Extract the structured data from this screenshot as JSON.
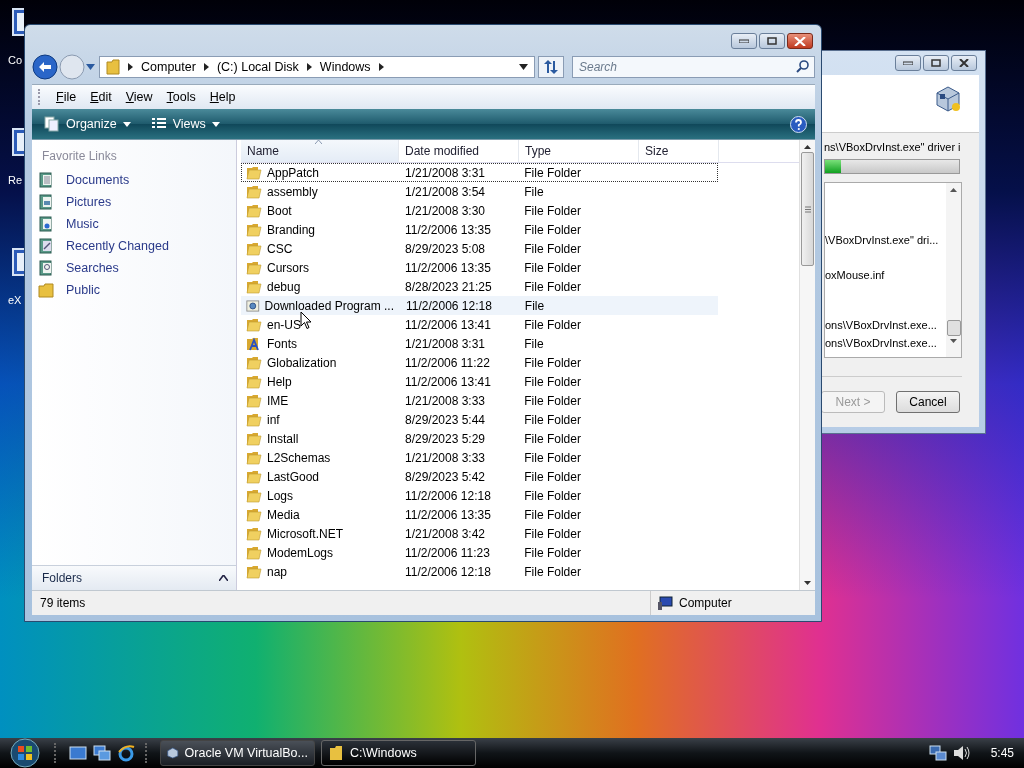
{
  "desktop_icons": [
    {
      "label": "Co"
    },
    {
      "label": "Re"
    },
    {
      "label": "eX"
    }
  ],
  "installer": {
    "status_text": "ns\\VBoxDrvInst.exe\" driver i",
    "progress": {
      "level": 0.12
    },
    "log": [
      "\\VBoxDrvInst.exe\" dri...",
      "oxMouse.inf",
      "ons\\VBoxDrvInst.exe...",
      "ons\\VBoxDrvInst.exe..."
    ],
    "buttons": [
      {
        "label": "Next >",
        "disabled": true
      },
      {
        "label": "Cancel",
        "disabled": false
      }
    ]
  },
  "explorer": {
    "address": {
      "crumbs": [
        "Computer",
        "(C:) Local Disk",
        "Windows"
      ]
    },
    "search": {
      "placeholder": "Search"
    },
    "menu": [
      "File",
      "Edit",
      "View",
      "Tools",
      "Help"
    ],
    "commands": [
      {
        "label": "Organize",
        "kind": "organize"
      },
      {
        "label": "Views",
        "kind": "views"
      }
    ],
    "favorite_links_title": "Favorite Links",
    "favorite_links": [
      {
        "label": "Documents",
        "kind": "documents"
      },
      {
        "label": "Pictures",
        "kind": "pictures"
      },
      {
        "label": "Music",
        "kind": "music"
      },
      {
        "label": "Recently Changed",
        "kind": "recent"
      },
      {
        "label": "Searches",
        "kind": "searches"
      },
      {
        "label": "Public",
        "kind": "folder"
      }
    ],
    "folders_label": "Folders",
    "columns": [
      {
        "label": "Name",
        "sorted": true
      },
      {
        "label": "Date modified",
        "sorted": false
      },
      {
        "label": "Type",
        "sorted": false
      },
      {
        "label": "Size",
        "sorted": false
      }
    ],
    "rows": [
      {
        "name": "AppPatch",
        "date": "1/21/2008 3:31",
        "type": "File Folder",
        "kind": "folder",
        "selected": true,
        "hovered": false
      },
      {
        "name": "assembly",
        "date": "1/21/2008 3:54",
        "type": "File",
        "kind": "folder",
        "selected": false,
        "hovered": false
      },
      {
        "name": "Boot",
        "date": "1/21/2008 3:30",
        "type": "File Folder",
        "kind": "folder",
        "selected": false,
        "hovered": false
      },
      {
        "name": "Branding",
        "date": "11/2/2006 13:35",
        "type": "File Folder",
        "kind": "folder",
        "selected": false,
        "hovered": false
      },
      {
        "name": "CSC",
        "date": "8/29/2023 5:08",
        "type": "File Folder",
        "kind": "folder",
        "selected": false,
        "hovered": false
      },
      {
        "name": "Cursors",
        "date": "11/2/2006 13:35",
        "type": "File Folder",
        "kind": "folder",
        "selected": false,
        "hovered": false
      },
      {
        "name": "debug",
        "date": "8/28/2023 21:25",
        "type": "File Folder",
        "kind": "folder",
        "selected": false,
        "hovered": false
      },
      {
        "name": "Downloaded Program ...",
        "date": "11/2/2006 12:18",
        "type": "File",
        "kind": "special",
        "selected": false,
        "hovered": true
      },
      {
        "name": "en-US",
        "date": "11/2/2006 13:41",
        "type": "File Folder",
        "kind": "folder",
        "selected": false,
        "hovered": false
      },
      {
        "name": "Fonts",
        "date": "1/21/2008 3:31",
        "type": "File",
        "kind": "fonts",
        "selected": false,
        "hovered": false
      },
      {
        "name": "Globalization",
        "date": "11/2/2006 11:22",
        "type": "File Folder",
        "kind": "folder",
        "selected": false,
        "hovered": false
      },
      {
        "name": "Help",
        "date": "11/2/2006 13:41",
        "type": "File Folder",
        "kind": "folder",
        "selected": false,
        "hovered": false
      },
      {
        "name": "IME",
        "date": "1/21/2008 3:33",
        "type": "File Folder",
        "kind": "folder",
        "selected": false,
        "hovered": false
      },
      {
        "name": "inf",
        "date": "8/29/2023 5:44",
        "type": "File Folder",
        "kind": "folder",
        "selected": false,
        "hovered": false
      },
      {
        "name": "Install",
        "date": "8/29/2023 5:29",
        "type": "File Folder",
        "kind": "folder",
        "selected": false,
        "hovered": false
      },
      {
        "name": "L2Schemas",
        "date": "1/21/2008 3:33",
        "type": "File Folder",
        "kind": "folder",
        "selected": false,
        "hovered": false
      },
      {
        "name": "LastGood",
        "date": "8/29/2023 5:42",
        "type": "File Folder",
        "kind": "folder",
        "selected": false,
        "hovered": false
      },
      {
        "name": "Logs",
        "date": "11/2/2006 12:18",
        "type": "File Folder",
        "kind": "folder",
        "selected": false,
        "hovered": false
      },
      {
        "name": "Media",
        "date": "11/2/2006 13:35",
        "type": "File Folder",
        "kind": "folder",
        "selected": false,
        "hovered": false
      },
      {
        "name": "Microsoft.NET",
        "date": "1/21/2008 3:42",
        "type": "File Folder",
        "kind": "folder",
        "selected": false,
        "hovered": false
      },
      {
        "name": "ModemLogs",
        "date": "11/2/2006 11:23",
        "type": "File Folder",
        "kind": "folder",
        "selected": false,
        "hovered": false
      },
      {
        "name": "nap",
        "date": "11/2/2006 12:18",
        "type": "File Folder",
        "kind": "folder",
        "selected": false,
        "hovered": false
      }
    ],
    "status": {
      "count": "79 items",
      "location": "Computer"
    }
  },
  "taskbar": {
    "buttons": [
      {
        "label": "Oracle VM VirtualBo...",
        "kind": "virtualbox",
        "selected": false
      },
      {
        "label": "C:\\Windows",
        "kind": "folder",
        "selected": true
      }
    ],
    "clock": "5:45"
  }
}
